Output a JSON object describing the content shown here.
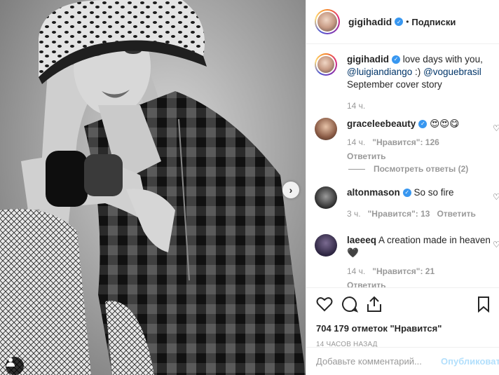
{
  "header": {
    "username": "gigihadid",
    "separator": "•",
    "follow_label": "Подписки"
  },
  "caption": {
    "username": "gigihadid",
    "text_1": "love days with you,",
    "mention_1": "@luigiandiango",
    "text_2": ":)",
    "mention_2": "@voguebrasil",
    "text_3": "September cover story",
    "time": "14 ч."
  },
  "comments": [
    {
      "username": "graceleebeauty",
      "text": "😍😍😋",
      "time": "14 ч.",
      "likes": "\"Нравится\": 126",
      "reply_label": "Ответить",
      "view_replies": "Посмотреть ответы (2)"
    },
    {
      "username": "altonmason",
      "text": "So so fire",
      "time": "3 ч.",
      "likes": "\"Нравится\": 13",
      "reply_label": "Ответить"
    },
    {
      "username": "laeeeq",
      "text": "A creation made in heaven",
      "text_2": "🖤",
      "time": "14 ч.",
      "likes": "\"Нравится\": 21",
      "reply_label": "Ответить"
    }
  ],
  "likes_count": "704 179 отметок \"Нравится\"",
  "post_time": "14 часов назад",
  "add_comment": {
    "placeholder": "Добавьте комментарий...",
    "publish_label": "Опубликовать"
  },
  "icons": {
    "carousel_next": "chevron-right-icon",
    "tag": "user-tag-icon",
    "like": "heart-icon",
    "comment": "comment-icon",
    "share": "share-icon",
    "bookmark": "bookmark-icon",
    "verified": "verified-badge-icon"
  },
  "colors": {
    "verified": "#3897f0",
    "link": "#003569",
    "muted": "#999999",
    "publish_disabled": "#b2dffc"
  }
}
